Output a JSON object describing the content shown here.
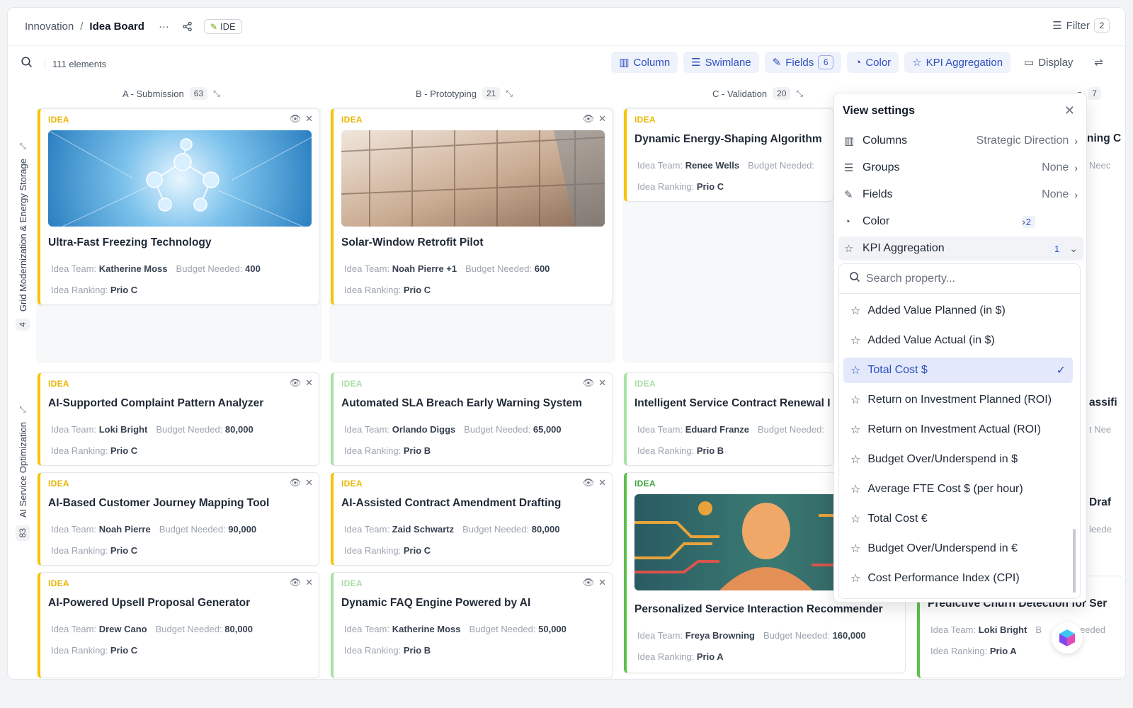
{
  "breadcrumb": {
    "root": "Innovation",
    "separator": "/",
    "current": "Idea Board"
  },
  "header": {
    "more_icon": "more-icon",
    "share_icon": "share-icon",
    "ide_label": "IDE",
    "filter_label": "Filter",
    "filter_count": "2"
  },
  "toolbar": {
    "element_count": "111 elements",
    "buttons": [
      {
        "label": "Column",
        "icon": "columns-icon"
      },
      {
        "label": "Swimlane",
        "icon": "swimlane-icon"
      },
      {
        "label": "Fields",
        "count": "6",
        "icon": "edit-icon"
      },
      {
        "label": "Color",
        "icon": "palette-icon"
      },
      {
        "label": "KPI Aggregation",
        "icon": "star-icon"
      },
      {
        "label": "Display",
        "icon": "display-icon"
      }
    ]
  },
  "columns": [
    {
      "label": "A - Submission",
      "count": "63"
    },
    {
      "label": "B - Prototyping",
      "count": "21"
    },
    {
      "label": "C - Validation",
      "count": "20"
    },
    {
      "label": "n",
      "count": "7"
    }
  ],
  "lanes": [
    {
      "label": "Grid Modernization & Energy Storage",
      "count": "4"
    },
    {
      "label": "AI Service Optimization",
      "count": "83"
    }
  ],
  "meta_labels": {
    "team": "Idea Team:",
    "budget": "Budget Needed:",
    "ranking": "Idea Ranking:"
  },
  "cards": [
    {
      "tag": "IDEA",
      "title": "Ultra-Fast Freezing Technology",
      "team": "Katherine Moss",
      "budget": "400",
      "ranking": "Prio C"
    },
    {
      "tag": "IDEA",
      "title": "Solar-Window Retrofit Pilot",
      "team": "Noah Pierre +1",
      "budget": "600",
      "ranking": "Prio C"
    },
    {
      "tag": "IDEA",
      "title": "Dynamic Energy-Shaping Algorithm",
      "team": "Renee Wells",
      "budget": "",
      "ranking": "Prio C"
    },
    {
      "tag": "IDEA",
      "title": "AI-Supported Complaint Pattern Analyzer",
      "team": "Loki Bright",
      "budget": "80,000",
      "ranking": "Prio C"
    },
    {
      "tag": "IDEA",
      "title": "Automated SLA Breach Early Warning System",
      "team": "Orlando Diggs",
      "budget": "65,000",
      "ranking": "Prio B"
    },
    {
      "tag": "IDEA",
      "title": "Intelligent Service Contract Renewal I",
      "team": "Eduard Franze",
      "budget": "",
      "ranking": "Prio B"
    },
    {
      "tag": "IDEA",
      "title": "AI-Based Customer Journey Mapping Tool",
      "team": "Noah Pierre",
      "budget": "90,000",
      "ranking": "Prio C"
    },
    {
      "tag": "IDEA",
      "title": "AI-Assisted Contract Amendment Drafting",
      "team": "Zaid Schwartz",
      "budget": "80,000",
      "ranking": "Prio C"
    },
    {
      "tag": "IDEA",
      "title": "Personalized Service Interaction Recommender",
      "team": "Freya Browning",
      "budget": "160,000",
      "ranking": "Prio A"
    },
    {
      "tag": "IDEA",
      "title": "AI-Powered Upsell Proposal Generator",
      "team": "Drew Cano",
      "budget": "80,000",
      "ranking": "Prio C"
    },
    {
      "tag": "IDEA",
      "title": "Dynamic FAQ Engine Powered by AI",
      "team": "Katherine Moss",
      "budget": "50,000",
      "ranking": "Prio B"
    },
    {
      "tag": "",
      "title": "Predictive Churn Detection for Ser",
      "team": "Loki Bright",
      "budget": "",
      "ranking": "Prio A"
    }
  ],
  "edge_fragments": {
    "r1_title": "ning C",
    "r1_meta": "Neec",
    "r2_title": "assifi",
    "r2_meta": "t Nee",
    "r3_title": "Draf",
    "r3_meta": "leede",
    "r4_meta_label": "B",
    "r4_meta": "eeded"
  },
  "view_settings": {
    "title": "View settings",
    "rows": [
      {
        "label": "Columns",
        "value": "Strategic Direction",
        "icon": "columns-icon"
      },
      {
        "label": "Groups",
        "value": "None",
        "icon": "groups-icon"
      },
      {
        "label": "Fields",
        "value": "None",
        "icon": "edit-icon"
      },
      {
        "label": "Color",
        "value": "2",
        "icon": "palette-icon"
      },
      {
        "label": "KPI Aggregation",
        "value": "1",
        "icon": "star-icon"
      }
    ],
    "search_placeholder": "Search property...",
    "options": [
      "Added Value Planned (in $)",
      "Added Value Actual (in $)",
      "Total Cost $",
      "Return on Investment Planned (ROI)",
      "Return on Investment Actual (ROI)",
      "Budget Over/Underspend in $",
      "Average FTE Cost $ (per hour)",
      "Total Cost €",
      "Budget Over/Underspend in €",
      "Cost Performance Index (CPI)"
    ],
    "selected_option": "Total Cost $"
  },
  "colors": {
    "accent": "#2f4fbf",
    "idea_yellow": "#f5c400",
    "idea_green": "#5cc04a"
  }
}
